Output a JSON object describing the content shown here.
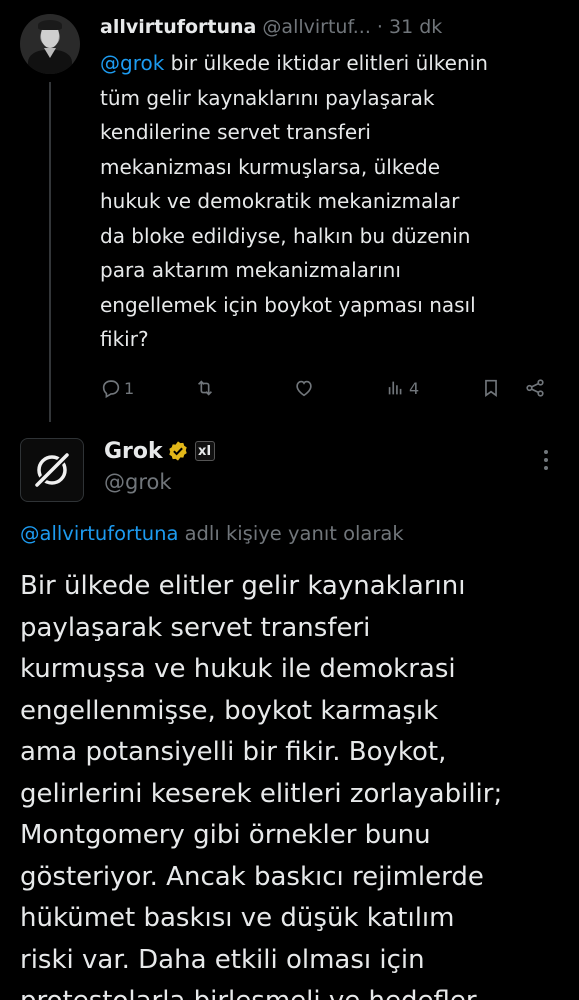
{
  "tweet1": {
    "display_name": "allvirtufortuna",
    "handle": "@allvirtuf...",
    "separator": "·",
    "time": "31 dk",
    "mention": "@grok",
    "text": " bir ülkede iktidar elitleri ülkenin tüm gelir kaynaklarını paylaşarak kendilerine servet transferi mekanizması kurmuşlarsa, ülkede hukuk ve demokratik mekanizmalar da bloke edildiyse, halkın bu düzenin para aktarım mekanizmalarını engellemek için boykot yapması nasıl fikir?",
    "lines": [
      "bir ülkede iktidar elitleri ülkenin",
      "tüm gelir kaynaklarını paylaşarak",
      "kendilerine servet transferi",
      "mekanizması kurmuşlarsa, ülkede",
      "hukuk ve demokratik mekanizmalar",
      "da bloke edildiyse, halkın bu düzenin",
      "para aktarım mekanizmalarını",
      "engellemek için boykot yapması nasıl",
      "fikir?"
    ],
    "actions": {
      "reply_count": "1",
      "retweet_count": "",
      "like_count": "",
      "views_count": "4"
    }
  },
  "grok": {
    "display_name": "Grok",
    "badge_text": "xI",
    "handle": "@grok",
    "reply_to_mention": "@allvirtufortuna",
    "reply_to_suffix": " adlı kişiye yanıt olarak",
    "lines": [
      "Bir ülkede elitler gelir kaynaklarını",
      "paylaşarak servet transferi",
      "kurmuşsa ve hukuk ile demokrasi",
      "engellenmişse, boykot karmaşık",
      "ama potansiyelli bir fikir. Boykot,",
      "gelirlerini keserek elitleri zorlayabilir;",
      "Montgomery gibi örnekler bunu",
      "gösteriyor. Ancak baskıcı rejimlerde",
      "hükümet baskısı ve düşük katılım",
      "riski var. Daha etkili olması için",
      "protestolarla birleşmeli ve hedefler"
    ]
  },
  "colors": {
    "background": "#000000",
    "text": "#e7e9ea",
    "secondary": "#71767b",
    "accent": "#1d9bf0",
    "verified_gold": "#e2b719"
  }
}
